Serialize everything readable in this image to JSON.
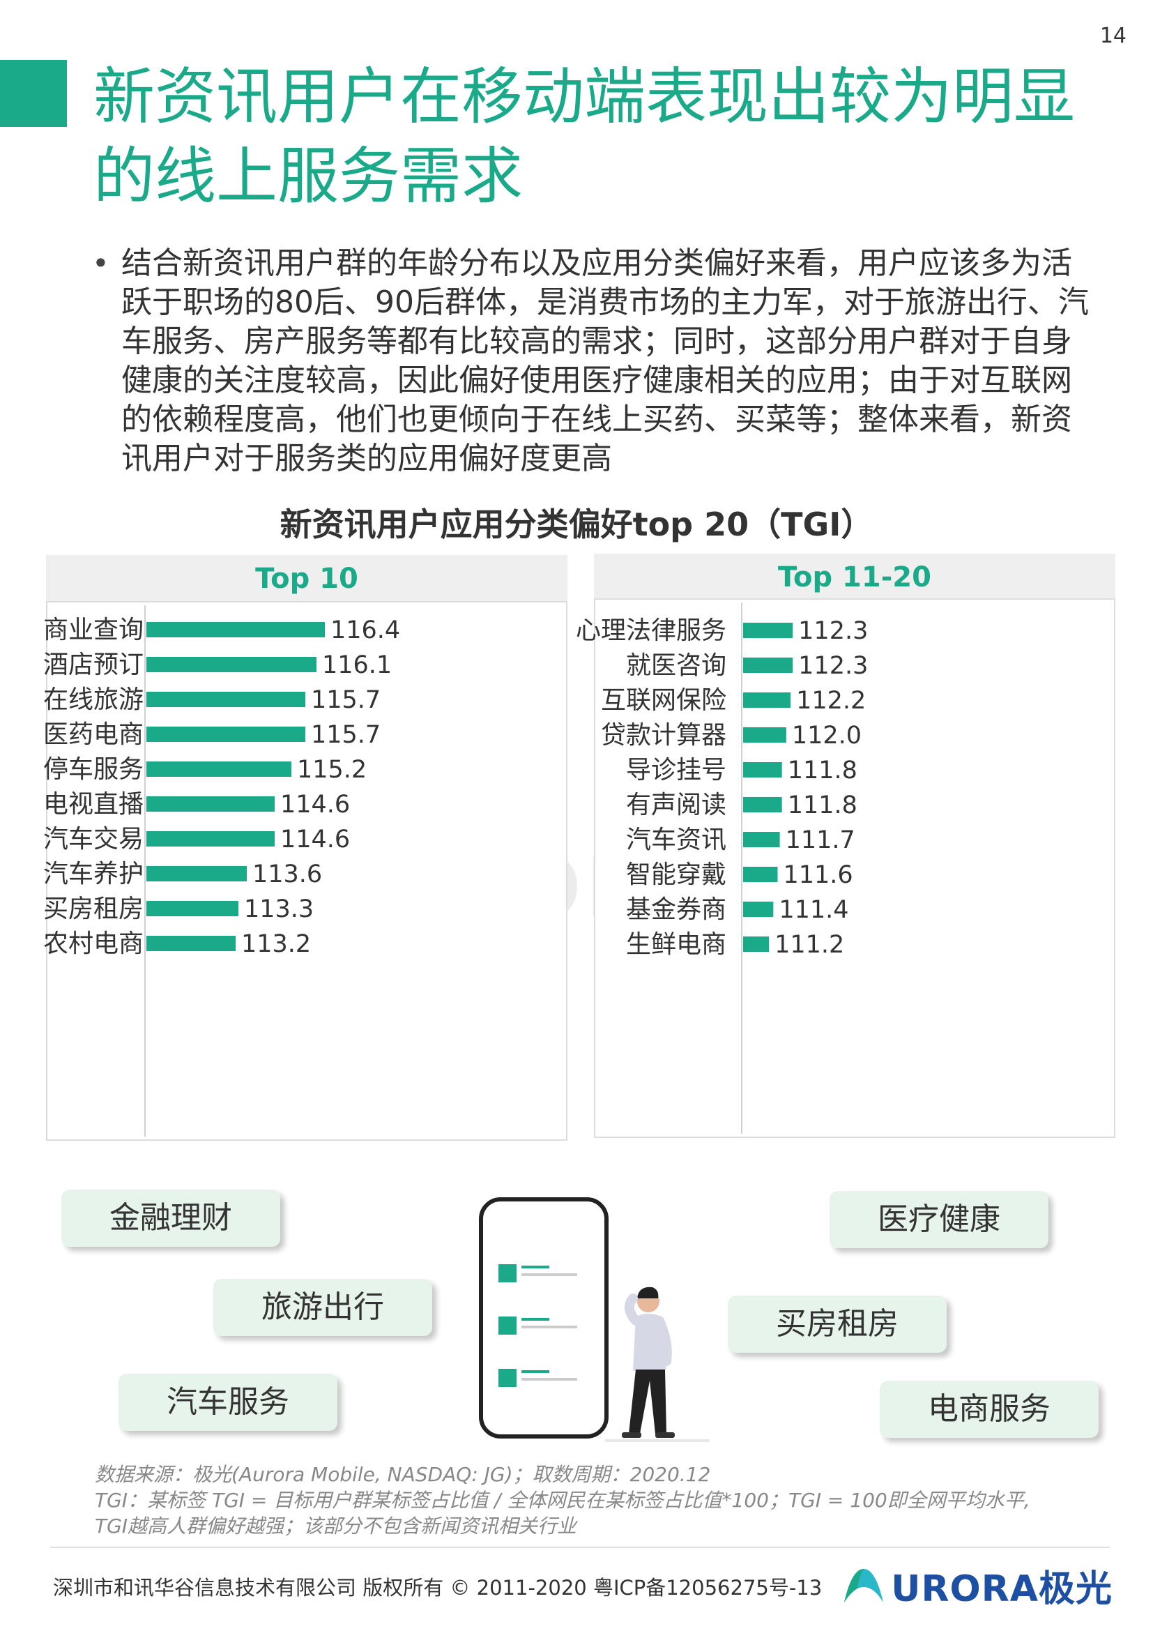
{
  "page_number": "14",
  "title": "新资讯用户在移动端表现出较为明显的线上服务需求",
  "bullet": "结合新资讯用户群的年龄分布以及应用分类偏好来看，用户应该多为活跃于职场的80后、90后群体，是消费市场的主力军，对于旅游出行、汽车服务、房产服务等都有比较高的需求；同时，这部分用户群对于自身健康的关注度较高，因此偏好使用医疗健康相关的应用；由于对互联网的依赖程度高，他们也更倾向于在线上买药、买菜等；整体来看，新资讯用户对于服务类的应用偏好度更高",
  "chart_title": "新资讯用户应用分类偏好top 20（TGI）",
  "chart_data": [
    {
      "type": "bar",
      "orientation": "horizontal",
      "title": "Top 10",
      "categories": [
        "商业查询",
        "酒店预订",
        "在线旅游",
        "医药电商",
        "停车服务",
        "电视直播",
        "汽车交易",
        "汽车养护",
        "买房租房",
        "农村电商"
      ],
      "values": [
        116.4,
        116.1,
        115.7,
        115.7,
        115.2,
        114.6,
        114.6,
        113.6,
        113.3,
        113.2
      ],
      "data_labels": [
        "116.4",
        "116.1",
        "115.7",
        "115.7",
        "115.2",
        "114.6",
        "114.6",
        "113.6",
        "113.3",
        "113.2"
      ],
      "xlim": [
        110,
        116.4
      ],
      "grid": false,
      "color": "#1aaa8a"
    },
    {
      "type": "bar",
      "orientation": "horizontal",
      "title": "Top 11-20",
      "categories": [
        "心理法律服务",
        "就医咨询",
        "互联网保险",
        "贷款计算器",
        "导诊挂号",
        "有声阅读",
        "汽车资讯",
        "智能穿戴",
        "基金券商",
        "生鲜电商"
      ],
      "values": [
        112.3,
        112.3,
        112.2,
        112.0,
        111.8,
        111.8,
        111.7,
        111.6,
        111.4,
        111.2
      ],
      "data_labels": [
        "112.3",
        "112.3",
        "112.2",
        "112.0",
        "111.8",
        "111.8",
        "111.7",
        "111.6",
        "111.4",
        "111.2"
      ],
      "xlim": [
        110,
        116.4
      ],
      "grid": false,
      "color": "#1aaa8a"
    }
  ],
  "tags": {
    "finance": "金融理财",
    "travel": "旅游出行",
    "auto": "汽车服务",
    "medical": "医疗健康",
    "house": "买房租房",
    "ecommerce": "电商服务"
  },
  "illustration": {
    "phone_icon": "smartphone-list-icon",
    "person_icon": "thinking-person-icon"
  },
  "source": {
    "line1": "数据来源：极光(Aurora Mobile, NASDAQ: JG)；取数周期：2020.12",
    "line2": "TGI：某标签 TGI = 目标用户群某标签占比值 / 全体网民在某标签占比值*100；TGI = 100即全网平均水平,",
    "line3": "TGI越高人群偏好越强；该部分不包含新闻资讯相关行业"
  },
  "footer": {
    "copyright": "深圳市和讯华谷信息技术有限公司 版权所有 © 2011-2020 粤ICP备12056275号-13",
    "logo_text": "URORA极光"
  },
  "watermark_text": "URORA极光",
  "colors": {
    "accent": "#1aaa8a",
    "pill_bg": "#e6f4ec",
    "logo_blue": "#1d4fa3"
  }
}
